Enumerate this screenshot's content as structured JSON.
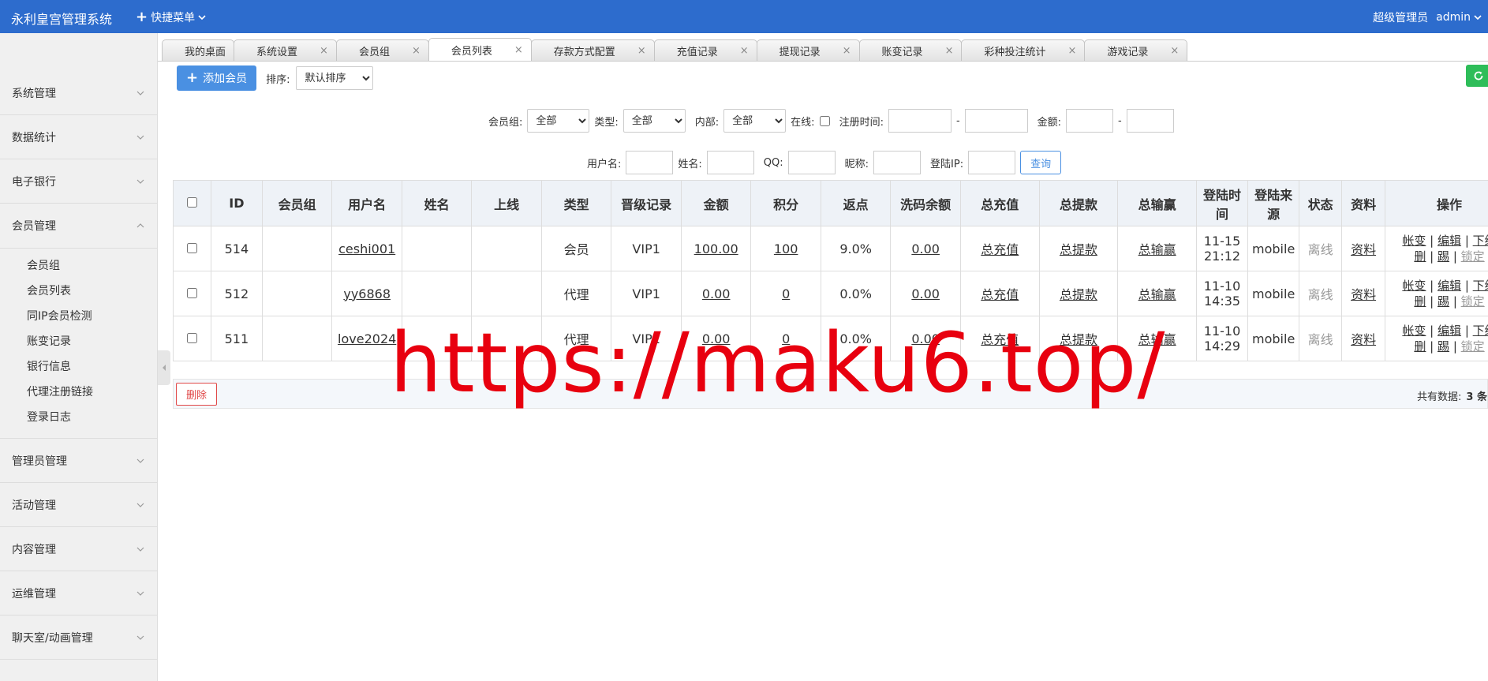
{
  "header": {
    "brand": "永利皇宫管理系统",
    "quick_menu": "快捷菜单",
    "role": "超级管理员",
    "user": "admin"
  },
  "sidebar": {
    "groups": [
      {
        "label": "系统管理"
      },
      {
        "label": "数据统计"
      },
      {
        "label": "电子银行"
      },
      {
        "label": "会员管理",
        "expanded": true,
        "items": [
          "会员组",
          "会员列表",
          "同IP会员检测",
          "账变记录",
          "银行信息",
          "代理注册链接",
          "登录日志"
        ]
      },
      {
        "label": "管理员管理"
      },
      {
        "label": "活动管理"
      },
      {
        "label": "内容管理"
      },
      {
        "label": "运维管理"
      },
      {
        "label": "聊天室/动画管理"
      }
    ]
  },
  "tabs": [
    {
      "label": "我的桌面",
      "closable": false
    },
    {
      "label": "系统设置",
      "closable": true
    },
    {
      "label": "会员组",
      "closable": true
    },
    {
      "label": "会员列表",
      "closable": true,
      "active": true
    },
    {
      "label": "存款方式配置",
      "closable": true
    },
    {
      "label": "充值记录",
      "closable": true
    },
    {
      "label": "提现记录",
      "closable": true
    },
    {
      "label": "账变记录",
      "closable": true
    },
    {
      "label": "彩种投注统计",
      "closable": true
    },
    {
      "label": "游戏记录",
      "closable": true
    }
  ],
  "toolbar": {
    "add_label": "添加会员",
    "sort_label": "排序:",
    "sort_value": "默认排序"
  },
  "filters": {
    "group_label": "会员组:",
    "group_value": "全部",
    "type_label": "类型:",
    "type_value": "全部",
    "internal_label": "内部:",
    "internal_value": "全部",
    "online_label": "在线:",
    "regtime_label": "注册时间:",
    "dash": "-",
    "amount_label": "金额:",
    "username_label": "用户名:",
    "name_label": "姓名:",
    "qq_label": "QQ:",
    "nickname_label": "昵称:",
    "loginip_label": "登陆IP:",
    "query_label": "查询"
  },
  "table": {
    "columns": [
      "ID",
      "会员组",
      "用户名",
      "姓名",
      "上线",
      "类型",
      "晋级记录",
      "金额",
      "积分",
      "返点",
      "洗码余额",
      "总充值",
      "总提款",
      "总输赢",
      "登陆时间",
      "登陆来源",
      "状态",
      "资料",
      "操作"
    ],
    "rows": [
      {
        "id": "514",
        "group": "",
        "username": "ceshi001",
        "name": "",
        "upline": "",
        "type": "会员",
        "level": "VIP1",
        "amount": "100.00",
        "points": "100",
        "rebate": "9.0%",
        "wash": "0.00",
        "recharge": "总充值",
        "withdraw": "总提款",
        "winloss": "总输赢",
        "login_time": "11-15 21:12",
        "login_source": "mobile",
        "status": "离线",
        "profile": "资料"
      },
      {
        "id": "512",
        "group": "",
        "username": "yy6868",
        "name": "",
        "upline": "",
        "type": "代理",
        "level": "VIP1",
        "amount": "0.00",
        "points": "0",
        "rebate": "0.0%",
        "wash": "0.00",
        "recharge": "总充值",
        "withdraw": "总提款",
        "winloss": "总输赢",
        "login_time": "11-10 14:35",
        "login_source": "mobile",
        "status": "离线",
        "profile": "资料"
      },
      {
        "id": "511",
        "group": "",
        "username": "love2024",
        "name": "",
        "upline": "",
        "type": "代理",
        "level": "VIP1",
        "amount": "0.00",
        "points": "0",
        "rebate": "0.0%",
        "wash": "0.00",
        "recharge": "总充值",
        "withdraw": "总提款",
        "winloss": "总输赢",
        "login_time": "11-10 14:29",
        "login_source": "mobile",
        "status": "离线",
        "profile": "资料"
      }
    ],
    "ops": {
      "account": "帐变",
      "edit": "编辑",
      "sub": "下级",
      "delete": "删",
      "kick": "踢",
      "lock": "锁定",
      "sep": "|"
    }
  },
  "footer": {
    "delete_label": "删除",
    "total_label": "共有数据:",
    "total_value": "3 条"
  },
  "watermark": "https://maku6.top/"
}
